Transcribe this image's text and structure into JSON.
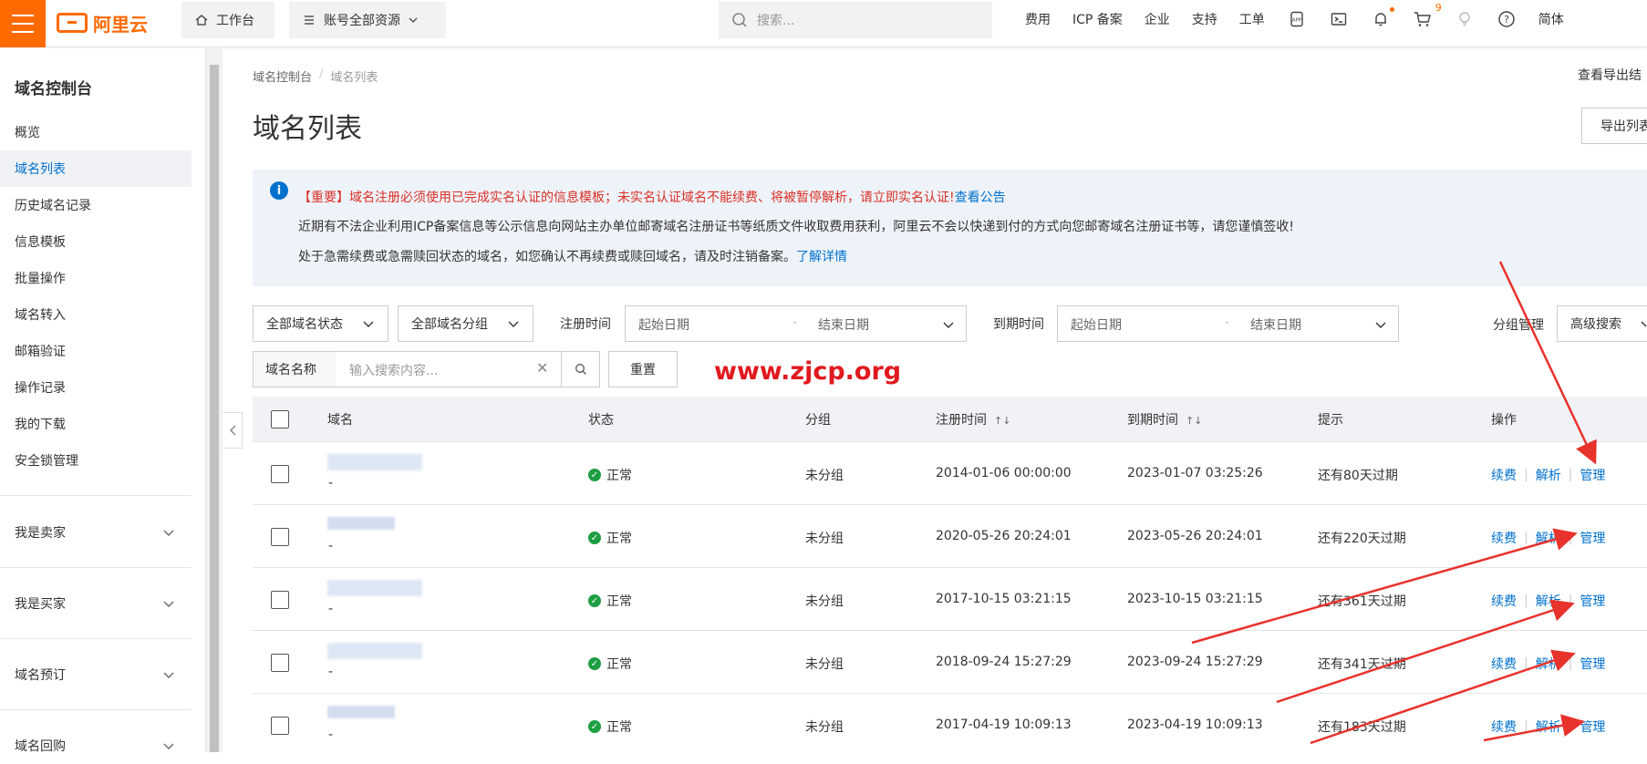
{
  "topbar": {
    "brand": "阿里云",
    "workbench": "工作台",
    "resources": "账号全部资源",
    "search_placeholder": "搜索...",
    "links": [
      "费用",
      "ICP 备案",
      "企业",
      "支持",
      "工单"
    ],
    "cart_badge": "9",
    "language": "简体"
  },
  "sidebar": {
    "title": "域名控制台",
    "items": [
      "概览",
      "域名列表",
      "历史域名记录",
      "信息模板",
      "批量操作",
      "域名转入",
      "邮箱验证",
      "操作记录",
      "我的下载",
      "安全锁管理"
    ],
    "active_index": 1,
    "groups": [
      "我是卖家",
      "我是买家",
      "域名预订",
      "域名回购"
    ]
  },
  "main": {
    "breadcrumb": [
      "域名控制台",
      "域名列表"
    ],
    "title": "域名列表",
    "top_right_link": "查看导出结",
    "export_button": "导出列表",
    "notice": {
      "line1": "【重要】域名注册必须使用已完成实名认证的信息模板；未实名认证域名不能续费、将被暂停解析，请立即实名认证!",
      "line1_link": "查看公告",
      "line2": "近期有不法企业利用ICP备案信息等公示信息向网站主办单位邮寄域名注册证书等纸质文件收取费用获利，阿里云不会以快递到付的方式向您邮寄域名注册证书等，请您谨慎签收!",
      "line3": "处于急需续费或急需赎回状态的域名，如您确认不再续费或赎回域名，请及时注销备案。",
      "line3_link": "了解详情"
    },
    "filters": {
      "status_select": "全部域名状态",
      "group_select": "全部域名分组",
      "reg_label": "注册时间",
      "exp_label": "到期时间",
      "start_date": "起始日期",
      "end_date": "结束日期",
      "range_sep": "-",
      "group_manage": "分组管理",
      "advanced_search": "高级搜索",
      "search_label": "域名名称",
      "search_placeholder": "输入搜索内容...",
      "reset": "重置"
    },
    "watermark": "www.zjcp.org",
    "table": {
      "headers": [
        "域名",
        "状态",
        "分组",
        "注册时间",
        "到期时间",
        "提示",
        "操作"
      ],
      "rows": [
        {
          "domain_sub": "-",
          "status": "正常",
          "group": "未分组",
          "reg": "2014-01-06 00:00:00",
          "exp": "2023-01-07 03:25:26",
          "hint": "还有80天过期"
        },
        {
          "domain_sub": "-",
          "status": "正常",
          "group": "未分组",
          "reg": "2020-05-26 20:24:01",
          "exp": "2023-05-26 20:24:01",
          "hint": "还有220天过期"
        },
        {
          "domain_sub": "-",
          "status": "正常",
          "group": "未分组",
          "reg": "2017-10-15 03:21:15",
          "exp": "2023-10-15 03:21:15",
          "hint": "还有361天过期"
        },
        {
          "domain_sub": "-",
          "status": "正常",
          "group": "未分组",
          "reg": "2018-09-24 15:27:29",
          "exp": "2023-09-24 15:27:29",
          "hint": "还有341天过期"
        },
        {
          "domain_sub": "-",
          "status": "正常",
          "group": "未分组",
          "reg": "2017-04-19 10:09:13",
          "exp": "2023-04-19 10:09:13",
          "hint": "还有183天过期"
        }
      ],
      "ops": [
        "续费",
        "解析",
        "管理"
      ]
    }
  },
  "colors": {
    "brand": "#ff6a00",
    "link": "#0070cc",
    "success": "#1e9e42",
    "alert": "#d93026",
    "arrow": "#e8322c"
  }
}
